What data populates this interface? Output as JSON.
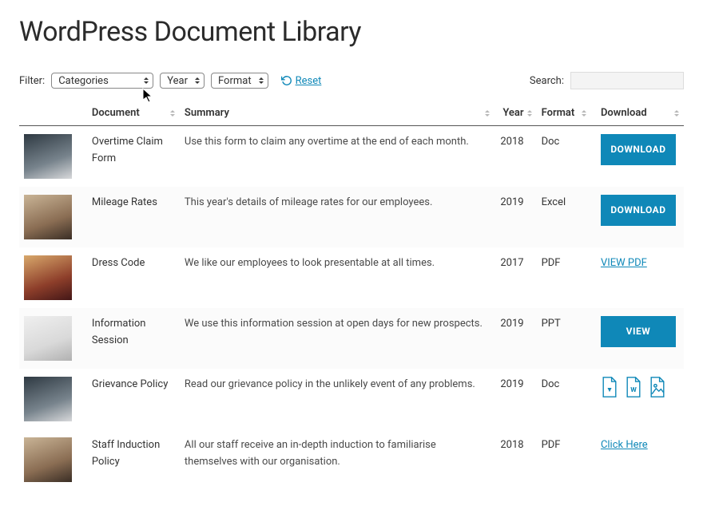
{
  "title": "WordPress Document Library",
  "filters": {
    "label": "Filter:",
    "categories": {
      "selected": "Categories"
    },
    "year": {
      "selected": "Year"
    },
    "format": {
      "selected": "Format"
    },
    "reset_label": "Reset"
  },
  "search": {
    "label": "Search:",
    "value": ""
  },
  "columns": {
    "thumb": "",
    "document": "Document",
    "summary": "Summary",
    "year": "Year",
    "format": "Format",
    "download": "Download"
  },
  "rows": [
    {
      "thumb_class": "t1",
      "document": "Overtime Claim Form",
      "summary": "Use this form to claim any overtime at the end of each month.",
      "year": "2018",
      "format": "Doc",
      "download_type": "button",
      "download_label": "DOWNLOAD"
    },
    {
      "thumb_class": "t2",
      "document": "Mileage Rates",
      "summary": "This year's details of mileage rates for our employees.",
      "year": "2019",
      "format": "Excel",
      "download_type": "button",
      "download_label": "DOWNLOAD"
    },
    {
      "thumb_class": "t3",
      "document": "Dress Code",
      "summary": "We like our employees to look presentable at all times.",
      "year": "2017",
      "format": "PDF",
      "download_type": "link",
      "download_label": "VIEW PDF"
    },
    {
      "thumb_class": "t4",
      "document": "Information Session",
      "summary": "We use this information session at open days for new prospects.",
      "year": "2019",
      "format": "PPT",
      "download_type": "button",
      "download_label": "VIEW"
    },
    {
      "thumb_class": "t5",
      "document": "Grievance Policy",
      "summary": "Read our grievance policy in the unlikely event of any problems.",
      "year": "2019",
      "format": "Doc",
      "download_type": "icons",
      "download_label": ""
    },
    {
      "thumb_class": "t6",
      "document": "Staff Induction Policy",
      "summary": "All our staff receive an in-depth induction to familiarise themselves with our organisation.",
      "year": "2018",
      "format": "PDF",
      "download_type": "link",
      "download_label": "Click Here"
    }
  ]
}
